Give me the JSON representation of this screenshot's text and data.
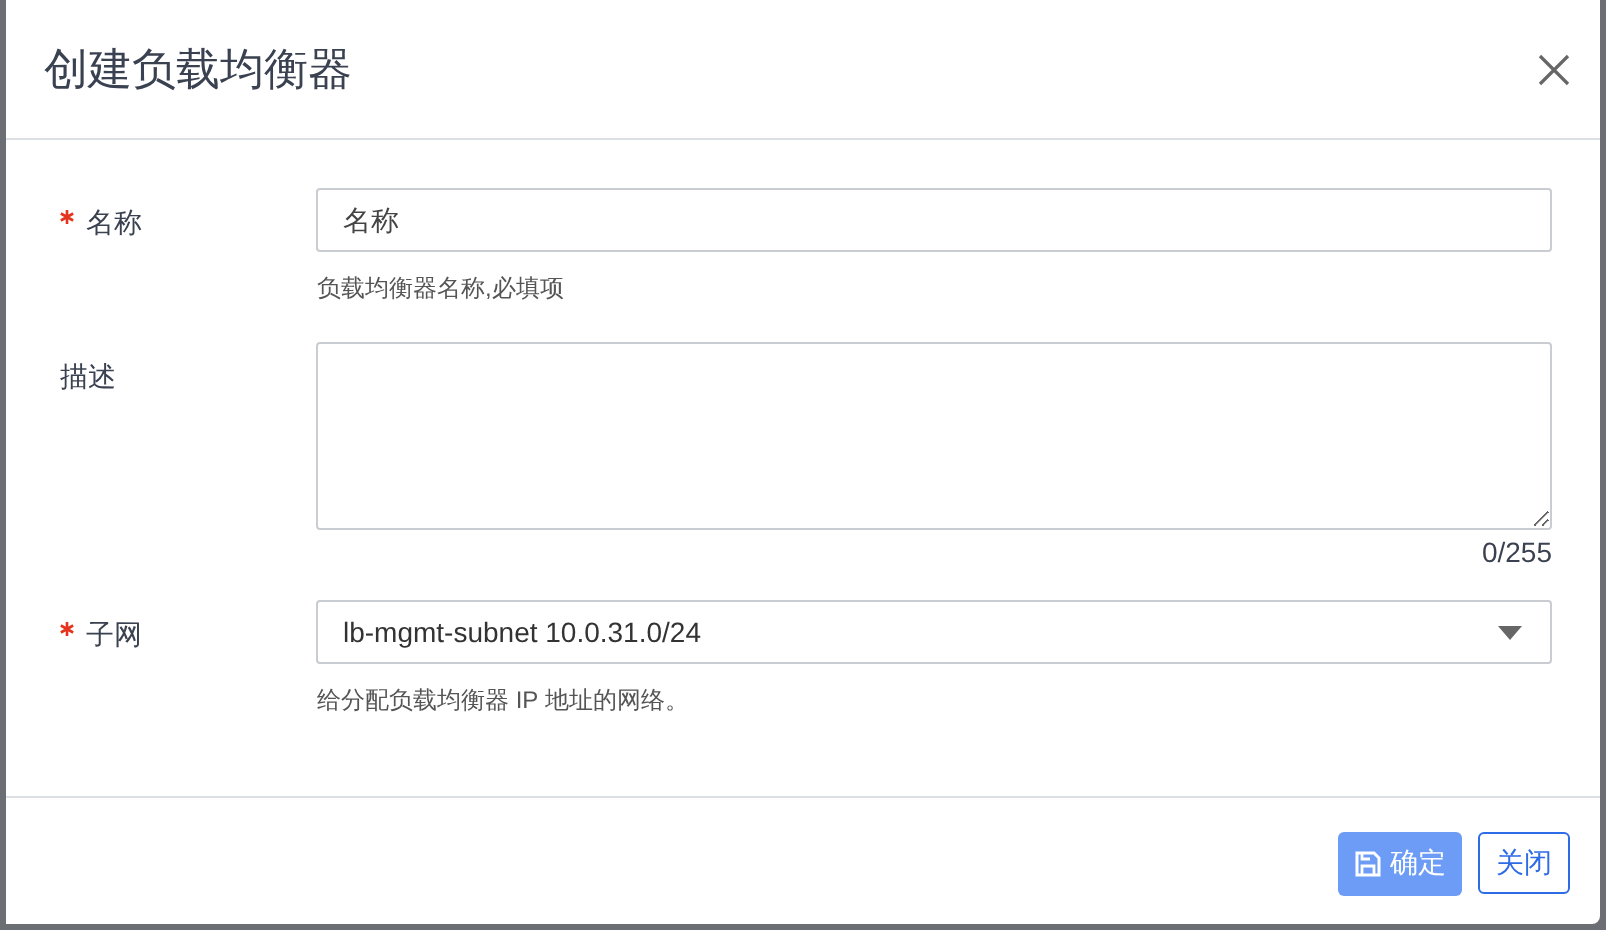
{
  "dialog": {
    "title": "创建负载均衡器",
    "fields": [
      {
        "kind": "text",
        "label": "名称",
        "required": true,
        "placeholder": "名称",
        "help": "负载均衡器名称,必填项"
      },
      {
        "kind": "textarea",
        "label": "描述",
        "required": false,
        "counter": "0/255"
      },
      {
        "kind": "select",
        "label": "子网",
        "required": true,
        "value": "lb-mgmt-subnet 10.0.31.0/24",
        "help": "给分配负载均衡器 IP 地址的网络。"
      }
    ],
    "buttons": [
      {
        "kind": "primary",
        "label": "确定",
        "disabled": true
      },
      {
        "kind": "secondary",
        "label": "关闭",
        "disabled": false
      }
    ]
  }
}
